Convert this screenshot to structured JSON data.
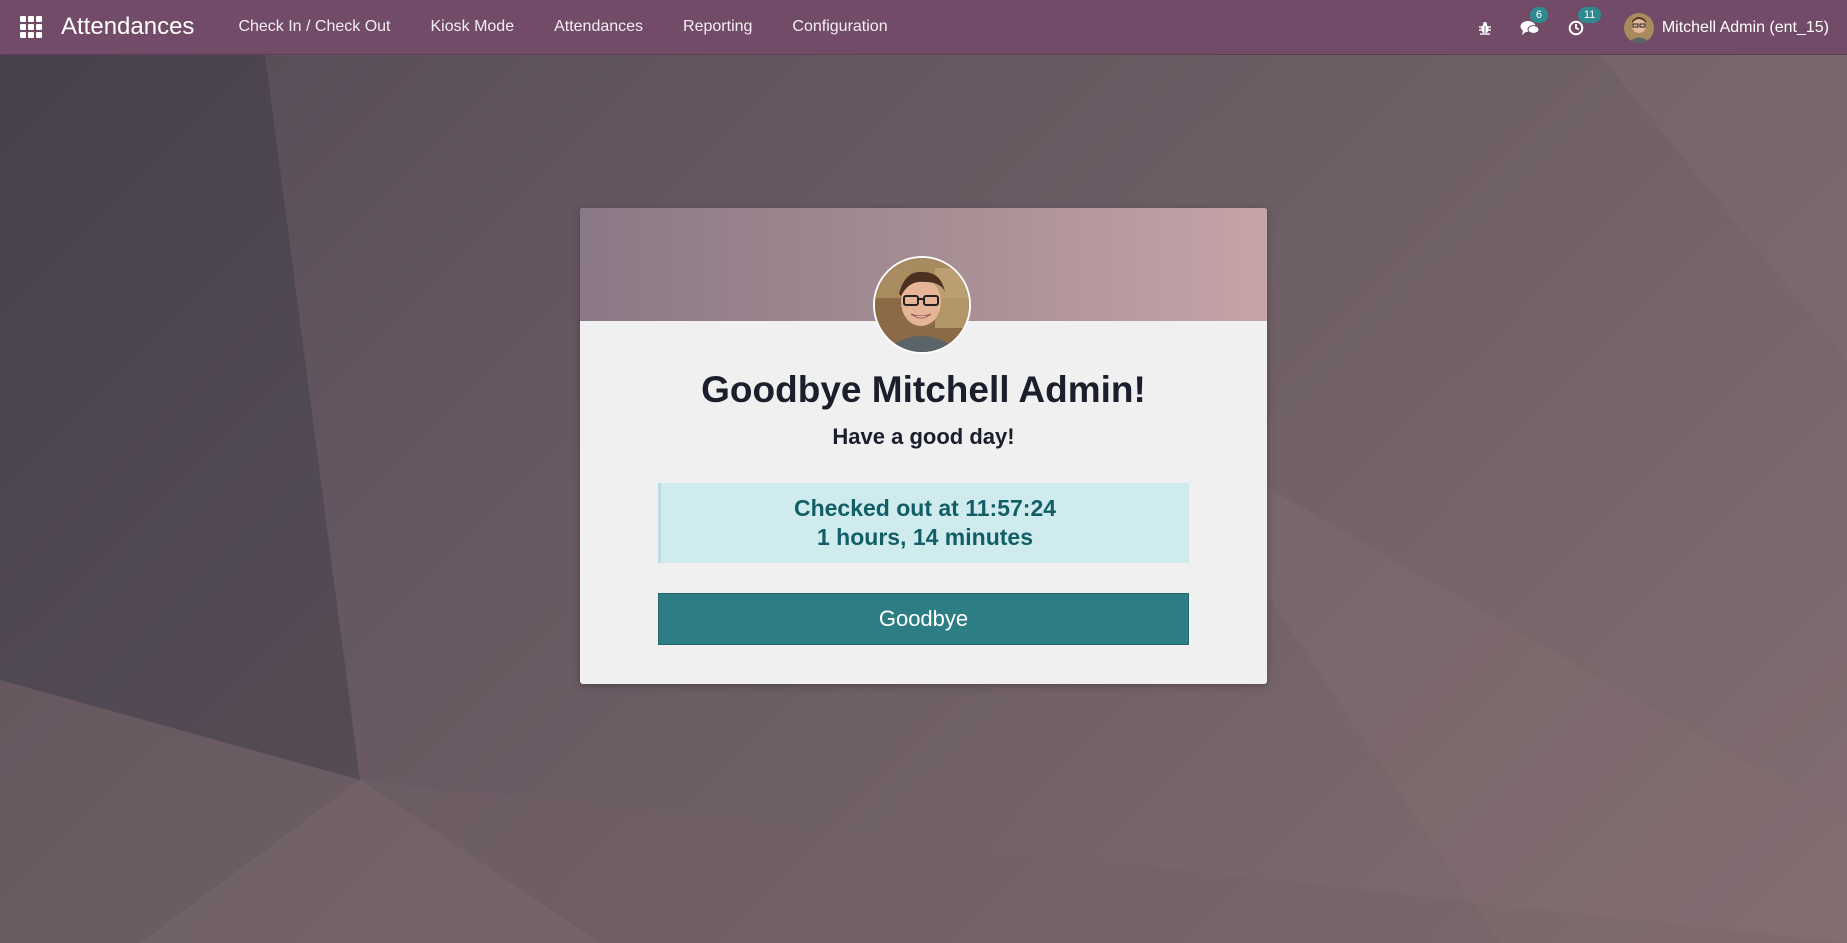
{
  "navbar": {
    "app_title": "Attendances",
    "menu": [
      {
        "label": "Check In / Check Out"
      },
      {
        "label": "Kiosk Mode"
      },
      {
        "label": "Attendances"
      },
      {
        "label": "Reporting"
      },
      {
        "label": "Configuration"
      }
    ],
    "icons": {
      "apps": "apps-grid-icon",
      "debug": "bug-icon",
      "messages": "chat-icon",
      "activities": "clock-icon"
    },
    "messages_count": "6",
    "activities_count": "11",
    "user_name": "Mitchell Admin (ent_15)"
  },
  "card": {
    "greeting": "Goodbye Mitchell Admin!",
    "subtitle": "Have a good day!",
    "checkout_line": "Checked out at 11:57:24",
    "duration_line": "1 hours, 14 minutes",
    "button_label": "Goodbye"
  },
  "colors": {
    "navbar": "#714b67",
    "badge": "#2e8a8f",
    "alert_bg": "#d0ebee",
    "alert_text": "#125e66",
    "button": "#2c7e84"
  }
}
